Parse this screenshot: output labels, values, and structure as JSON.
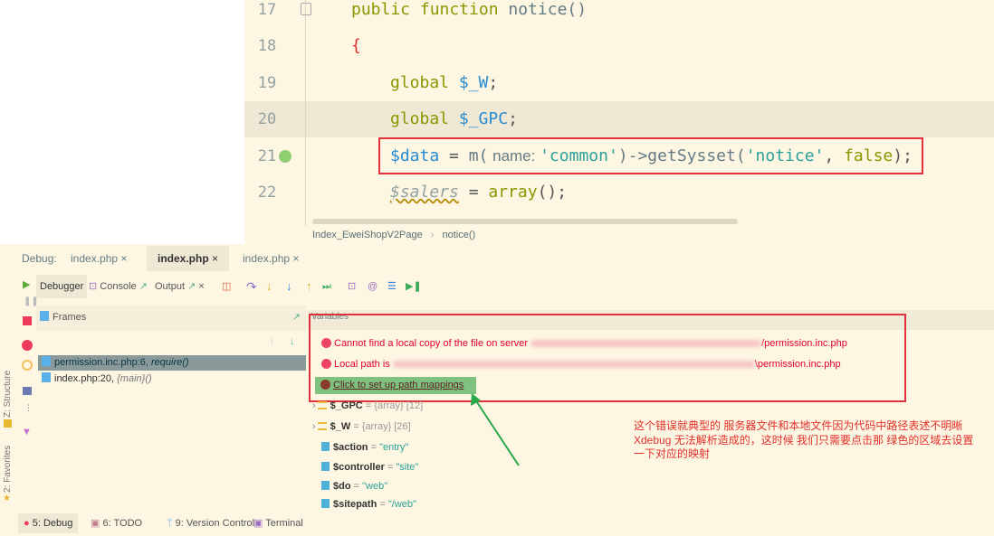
{
  "editor": {
    "lines": [
      {
        "num": "17"
      },
      {
        "num": "18"
      },
      {
        "num": "19"
      },
      {
        "num": "20"
      },
      {
        "num": "21"
      },
      {
        "num": "22"
      }
    ],
    "tokens": {
      "l17_kw": "public function",
      "l17_fn": " notice()",
      "l18": "{",
      "l19_kw": "global",
      "l19_var": " $_W",
      ";": ";",
      "l20_kw": "global",
      "l20_var": " $_GPC",
      "l21_var": "$data",
      " eq": " = ",
      "l21_m": "m(",
      "l21_hint": " name: ",
      "l21_str1": "'common'",
      "l21_call": ")->getSysset(",
      "l21_str2": "'notice'",
      "l21_comma": ", ",
      "l21_false": "false",
      "l21_end": ");",
      "l22_var": "$salers",
      "l22_eq": " = ",
      "l22_fn": "array",
      "l22_end": "();"
    },
    "breadcrumb": [
      "Index_EweiShopV2Page",
      "notice()"
    ],
    "breadcrumb_sep": "›"
  },
  "debug": {
    "label": "Debug:",
    "tabs": [
      "index.php",
      "index.php",
      "index.php"
    ],
    "close": "×",
    "toolbar": {
      "debugger": "Debugger",
      "console": "Console",
      "output": "Output"
    },
    "frames_title": "Frames",
    "frames": [
      {
        "name": "permission.inc.php:6,",
        "fn": "require()"
      },
      {
        "name": "index.php:20,",
        "fn": "{main}()"
      }
    ],
    "variables_title": "Variables",
    "errors": {
      "cannot_find": "Cannot find a local copy of the file on server",
      "server_suffix": "/permission.inc.php",
      "local_path": "Local path is",
      "local_suffix": "\\permission.inc.php",
      "mappings_link": "Click to set up path mappings"
    },
    "vars": [
      {
        "name": "$_GPC",
        "eq": " = ",
        "type": "{array}",
        "count": "[12]"
      },
      {
        "name": "$_W",
        "eq": " = ",
        "type": "{array}",
        "count": "[26]"
      },
      {
        "name": "$action",
        "eq": " = ",
        "val": "\"entry\""
      },
      {
        "name": "$controller",
        "eq": " = ",
        "val": "\"site\""
      },
      {
        "name": "$do",
        "eq": " = ",
        "val": "\"web\""
      },
      {
        "name": "$sitepath",
        "eq": " = ",
        "val": "\"/web\""
      }
    ]
  },
  "annotation": {
    "text": "这个错误就典型的 服务器文件和本地文件因为代码中路径表述不明晰 Xdebug 无法解析造成的，这时候 我们只需要点击那 绿色的区域去设置一下对应的映射"
  },
  "sidebar": {
    "structure": "Z: Structure",
    "favorites": "2: Favorites"
  },
  "bottombar": {
    "debug": "5: Debug",
    "todo": "6: TODO",
    "vcs": "9: Version Control",
    "terminal": "Terminal"
  },
  "colors": {
    "background": "#fdf6e3",
    "highlight_box": "#e0303a",
    "link_bg": "#7fc27f",
    "arrow": "#2aa84a"
  }
}
